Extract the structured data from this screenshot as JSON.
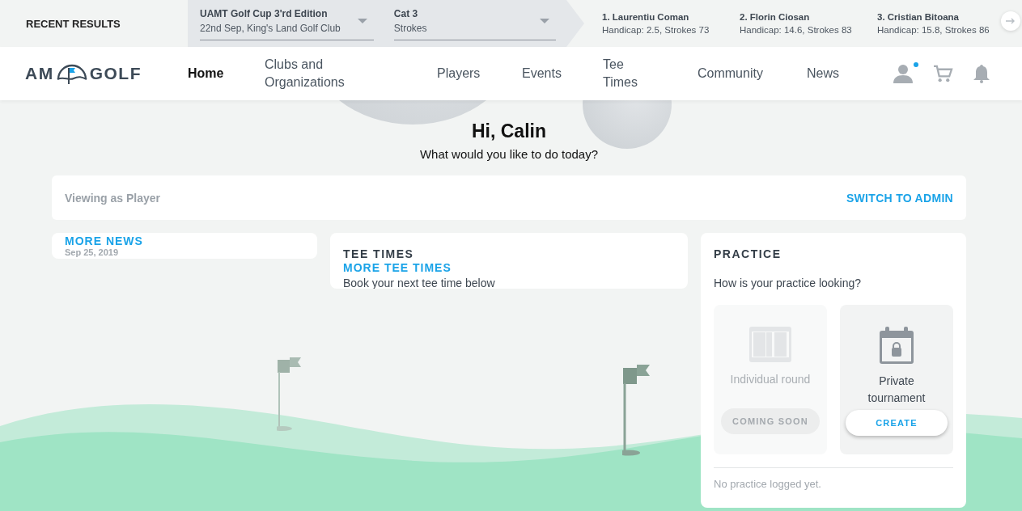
{
  "recent_results": {
    "label": "RECENT RESULTS",
    "selects": [
      {
        "title": "UAMT Golf Cup 3'rd Edition",
        "subtitle": "22nd Sep, King's Land Golf Club"
      },
      {
        "title": "Cat 3",
        "subtitle": "Strokes"
      }
    ],
    "results": [
      {
        "name": "1. Laurentiu Coman",
        "detail": "Handicap: 2.5, Strokes 73"
      },
      {
        "name": "2. Florin Ciosan",
        "detail": "Handicap: 14.6, Strokes 83"
      },
      {
        "name": "3. Cristian Bitoana",
        "detail": "Handicap: 15.8, Strokes 86"
      }
    ]
  },
  "nav": {
    "logo": {
      "left": "AM",
      "right": "GOLF"
    },
    "items": [
      {
        "label": "Home",
        "selected": true
      },
      {
        "label": "Clubs and Organizations",
        "selected": false
      },
      {
        "label": "Players",
        "selected": false
      },
      {
        "label": "Events",
        "selected": false
      },
      {
        "label": "Tee Times",
        "selected": false
      },
      {
        "label": "Community",
        "selected": false
      },
      {
        "label": "News",
        "selected": false
      }
    ],
    "profile_notification": true
  },
  "greeting": {
    "title": "Hi, Calin",
    "subtitle": "What would you like to do today?"
  },
  "viewing": {
    "text": "Viewing as **Player**",
    "action": "SWITCH TO ADMIN"
  },
  "news_card": {
    "link": "MORE NEWS",
    "date": "Sep 25, 2019"
  },
  "tee_times_card": {
    "title": "TEE TIMES",
    "link": "MORE TEE TIMES",
    "text": "Book your next tee time below"
  },
  "practice_card": {
    "title": "PRACTICE",
    "question": "How is your practice looking?",
    "options": [
      {
        "kind": "grid",
        "label": "Individual round",
        "button": "COMING SOON",
        "disabled": true
      },
      {
        "kind": "lock",
        "label": "Private tournament",
        "button": "CREATE",
        "disabled": false
      }
    ],
    "empty": "No practice logged yet."
  }
}
